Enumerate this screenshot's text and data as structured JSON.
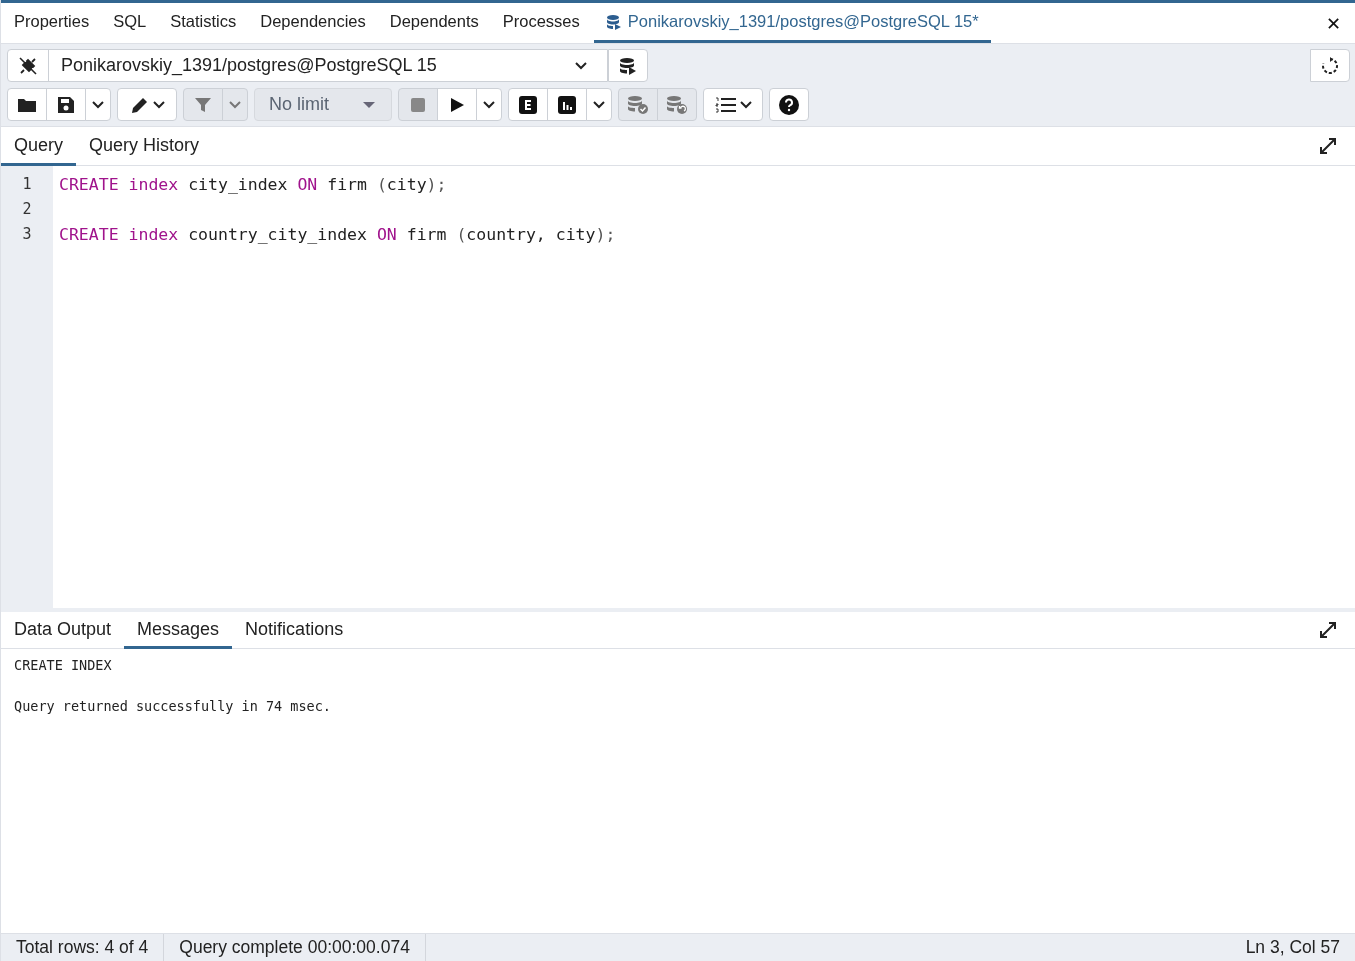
{
  "top_tabs": [
    {
      "label": "Properties",
      "selected": false,
      "icon": false
    },
    {
      "label": "SQL",
      "selected": false,
      "icon": false
    },
    {
      "label": "Statistics",
      "selected": false,
      "icon": false
    },
    {
      "label": "Dependencies",
      "selected": false,
      "icon": false
    },
    {
      "label": "Dependents",
      "selected": false,
      "icon": false
    },
    {
      "label": "Processes",
      "selected": false,
      "icon": false
    },
    {
      "label": "Ponikarovskiy_1391/postgres@PostgreSQL 15*",
      "selected": true,
      "icon": true
    }
  ],
  "close_symbol": "✕",
  "connection": {
    "value": "Ponikarovskiy_1391/postgres@PostgreSQL 15"
  },
  "limit": {
    "value": "No limit"
  },
  "editor_tabs": [
    {
      "label": "Query",
      "selected": true
    },
    {
      "label": "Query History",
      "selected": false
    }
  ],
  "code_lines": [
    {
      "number": "1",
      "tokens": [
        {
          "text": "CREATE ",
          "kind": "keyword"
        },
        {
          "text": "index",
          "kind": "keyword"
        },
        {
          "text": " city_index ",
          "kind": "plain"
        },
        {
          "text": "ON",
          "kind": "keyword"
        },
        {
          "text": " firm ",
          "kind": "plain"
        },
        {
          "text": "(",
          "kind": "punct"
        },
        {
          "text": "city",
          "kind": "plain"
        },
        {
          "text": ");",
          "kind": "punct"
        }
      ]
    },
    {
      "number": "2"
    },
    {
      "number": "3",
      "tokens": [
        {
          "text": "CREATE ",
          "kind": "keyword"
        },
        {
          "text": "index",
          "kind": "keyword"
        },
        {
          "text": " country_city_index ",
          "kind": "plain"
        },
        {
          "text": "ON",
          "kind": "keyword"
        },
        {
          "text": " firm ",
          "kind": "plain"
        },
        {
          "text": "(",
          "kind": "punct"
        },
        {
          "text": "country, city",
          "kind": "plain"
        },
        {
          "text": ");",
          "kind": "punct"
        }
      ]
    }
  ],
  "output_tabs": [
    {
      "label": "Data Output",
      "selected": false
    },
    {
      "label": "Messages",
      "selected": true
    },
    {
      "label": "Notifications",
      "selected": false
    }
  ],
  "messages": [
    "CREATE INDEX",
    "Query returned successfully in 74 msec."
  ],
  "status_bar": {
    "rows": "Total rows: 4 of 4",
    "query": "Query complete 00:00:00.074",
    "position": "Ln 3, Col 57"
  }
}
